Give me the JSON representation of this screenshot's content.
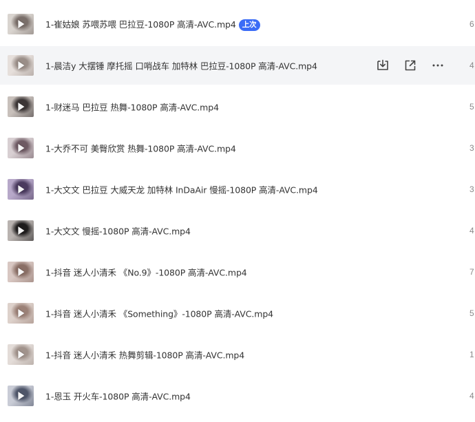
{
  "files": [
    {
      "name": "1-崔姑娘 苏喂苏喂 巴拉豆-1080P 高清-AVC.mp4",
      "badge": "上次",
      "meta": "6",
      "thumb": [
        "#d9d4cf",
        "#7a6f6a"
      ]
    },
    {
      "name": "1-晨洁y 大摆锤 摩托摇 口哨战车 加特林 巴拉豆-1080P 高清-AVC.mp4",
      "meta": "4",
      "hover": true,
      "thumb": [
        "#e6dfdb",
        "#9a8e88"
      ]
    },
    {
      "name": "1-财迷马 巴拉豆 热舞-1080P 高清-AVC.mp4",
      "meta": "5",
      "thumb": [
        "#c8c0bb",
        "#3b3535"
      ]
    },
    {
      "name": "1-大乔不可 美臀欣赏 热舞-1080P 高清-AVC.mp4",
      "meta": "3",
      "thumb": [
        "#d8cfd2",
        "#6e5a63"
      ]
    },
    {
      "name": "1-大文文 巴拉豆 大威天龙 加特林 InDaAir 慢摇-1080P 高清-AVC.mp4",
      "meta": "3",
      "thumb": [
        "#b7a8c9",
        "#4a3a5e"
      ]
    },
    {
      "name": "1-大文文 慢摇-1080P 高清-AVC.mp4",
      "meta": "4",
      "thumb": [
        "#b9b3b0",
        "#1e1c1c"
      ]
    },
    {
      "name": "1-抖音 迷人小清禾 《No.9》-1080P 高清-AVC.mp4",
      "meta": "7",
      "thumb": [
        "#d8c7c2",
        "#8a6f66"
      ]
    },
    {
      "name": "1-抖音 迷人小清禾 《Something》-1080P 高清-AVC.mp4",
      "meta": "5",
      "thumb": [
        "#ddd1cb",
        "#9b8177"
      ]
    },
    {
      "name": "1-抖音 迷人小清禾 热舞剪辑-1080P 高清-AVC.mp4",
      "meta": "1",
      "thumb": [
        "#e3dcd8",
        "#a1938c"
      ]
    },
    {
      "name": "1-恩玉 开火车-1080P 高清-AVC.mp4",
      "meta": "4",
      "thumb": [
        "#c9ccd6",
        "#4e5569"
      ]
    }
  ],
  "hover_actions": [
    {
      "icon": "download-icon"
    },
    {
      "icon": "share-icon"
    },
    {
      "icon": "more-icon"
    }
  ]
}
